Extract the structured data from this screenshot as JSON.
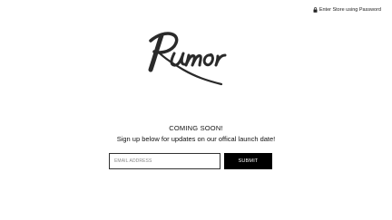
{
  "header": {
    "password_link_label": "Enter Store using Password",
    "lock_icon": "lock-icon"
  },
  "logo": {
    "text": "Rumor",
    "color": "#2a2a2a"
  },
  "main": {
    "heading": "COMING SOON!",
    "subheading": "Sign up below for updates on our offical launch date!"
  },
  "form": {
    "email_placeholder": "EMAIL ADDRESS",
    "email_value": "",
    "submit_label": "SUBMIT"
  },
  "colors": {
    "button_background": "#000000",
    "button_text": "#ffffff",
    "page_background": "#ffffff"
  }
}
